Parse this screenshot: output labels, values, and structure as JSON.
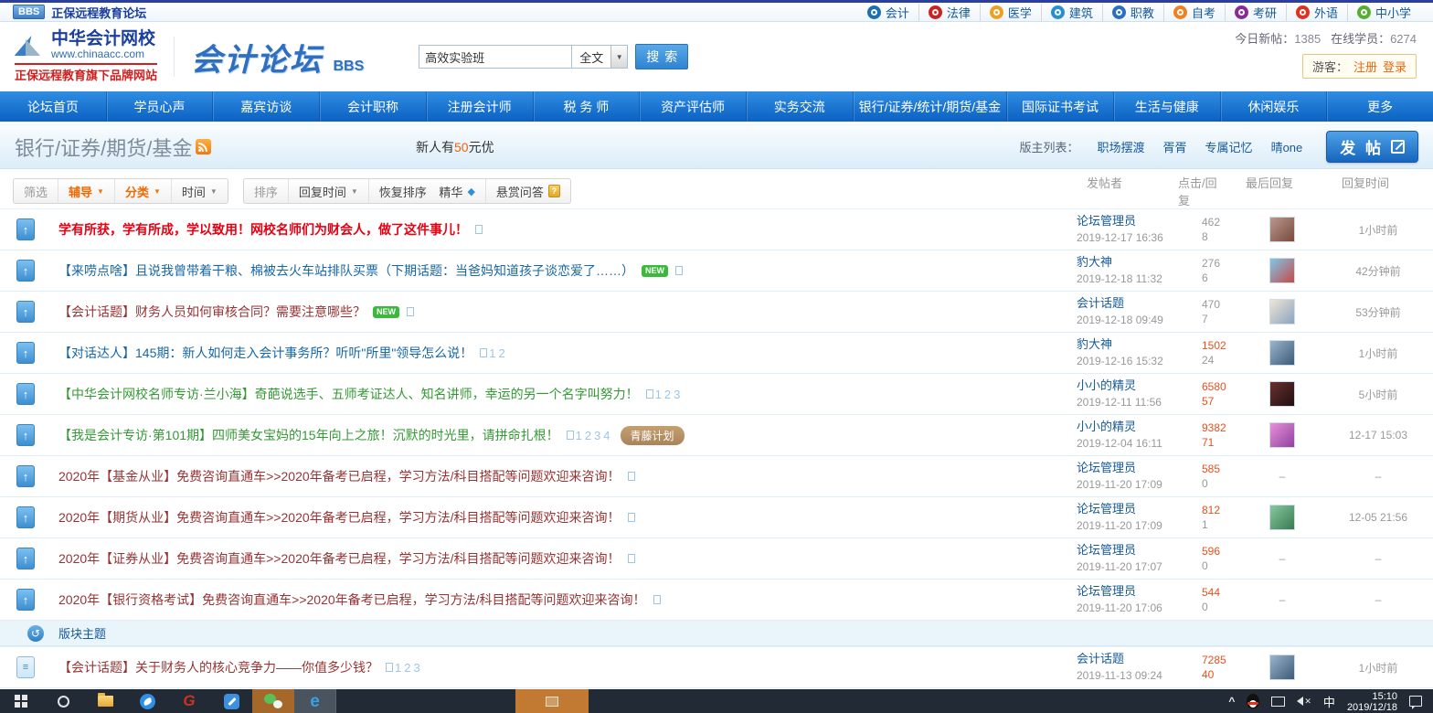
{
  "topbar": {
    "bbs_badge": "BBS",
    "site_title": "正保远程教育论坛",
    "links": [
      {
        "label": "会计",
        "color": "#1a6fb5"
      },
      {
        "label": "法律",
        "color": "#cc2222"
      },
      {
        "label": "医学",
        "color": "#f0a020"
      },
      {
        "label": "建筑",
        "color": "#2a8fd0"
      },
      {
        "label": "职教",
        "color": "#2a6fc0"
      },
      {
        "label": "自考",
        "color": "#f08020"
      },
      {
        "label": "考研",
        "color": "#8a2a9a"
      },
      {
        "label": "外语",
        "color": "#e03020"
      },
      {
        "label": "中小学",
        "color": "#55b030"
      }
    ]
  },
  "header": {
    "logo_title": "中华会计网校",
    "logo_url": "www.chinaacc.com",
    "logo_slogan": "正保远程教育旗下品牌网站",
    "forum_title": "会计论坛",
    "forum_suffix": "BBS",
    "search": {
      "value": "高效实验班",
      "scope": "全文",
      "button": "搜索"
    },
    "stats": {
      "today_label": "今日新帖：",
      "today_value": "1385",
      "online_label": "在线学员：",
      "online_value": "6274"
    },
    "guest": {
      "label": "游客：",
      "register": "注册",
      "login": "登录"
    }
  },
  "nav": {
    "items": [
      "论坛首页",
      "学员心声",
      "嘉宾访谈",
      "会计职称",
      "注册会计师",
      "税 务 师",
      "资产评估师",
      "实务交流",
      "银行/证券/统计/期货/基金",
      "国际证书考试",
      "生活与健康",
      "休闲娱乐",
      "更多"
    ]
  },
  "board": {
    "title": "银行/证券/期货/基金",
    "promo_prefix": "新人有",
    "promo_num": "50",
    "promo_suffix": "元优",
    "moderator_label": "版主列表：",
    "moderators": [
      "职场摆渡",
      "胥胥",
      "专属记忆",
      "晴one"
    ],
    "post_button": "发 帖"
  },
  "toolbar": {
    "filter_label": "筛选",
    "filter_tutoring": "辅导",
    "filter_category": "分类",
    "filter_time": "时间",
    "sort_label": "排序",
    "sort_value": "回复时间",
    "restore": "恢复排序",
    "digest": "精华",
    "bounty": "悬赏问答",
    "columns": {
      "author": "发帖者",
      "views": "点击/回复",
      "last_reply": "最后回复",
      "reply_time": "回复时间"
    }
  },
  "badge_new_text": "NEW",
  "section_row": {
    "label": "版块主题"
  },
  "threads": [
    {
      "title": "学有所获，学有所成，学以致用！网校名师们为财会人，做了这件事儿！",
      "color": "#e60012",
      "bold": true,
      "new": false,
      "pages": "",
      "tag": "",
      "author": "论坛管理员",
      "date": "2019-12-17 16:36",
      "views": "462",
      "views_hot": false,
      "replies": "8",
      "replies_hot": false,
      "avatar": {
        "c1": "#b89890",
        "c2": "#7a4a3a"
      },
      "last": "1小时前"
    },
    {
      "title": "【来唠点啥】且说我曾带着干粮、棉被去火车站排队买票（下期话题：当爸妈知道孩子谈恋爱了……）",
      "color": "#1667a7",
      "bold": false,
      "new": true,
      "pages": "",
      "tag": "",
      "author": "豹大神",
      "date": "2019-12-18 11:32",
      "views": "276",
      "views_hot": false,
      "replies": "6",
      "replies_hot": false,
      "avatar": {
        "c1": "#7ec8e8",
        "c2": "#c84848"
      },
      "last": "42分钟前"
    },
    {
      "title": "【会计话题】财务人员如何审核合同？需要注意哪些？",
      "color": "#993333",
      "bold": false,
      "new": true,
      "pages": "",
      "tag": "",
      "author": "会计话题",
      "date": "2019-12-18 09:49",
      "views": "470",
      "views_hot": false,
      "replies": "7",
      "replies_hot": false,
      "avatar": {
        "c1": "#f0e4d4",
        "c2": "#8aa4c0"
      },
      "last": "53分钟前"
    },
    {
      "title": "【对话达人】145期：新人如何走入会计事务所？听听\"所里\"领导怎么说！",
      "color": "#1667a7",
      "bold": false,
      "new": false,
      "pages": "12",
      "tag": "",
      "author": "豹大神",
      "date": "2019-12-16 15:32",
      "views": "1502",
      "views_hot": true,
      "replies": "24",
      "replies_hot": false,
      "avatar": {
        "c1": "#9ab4cc",
        "c2": "#3c5a78"
      },
      "last": "1小时前"
    },
    {
      "title": "【中华会计网校名师专访·兰小海】奇葩说选手、五师考证达人、知名讲师，幸运的另一个名字叫努力！",
      "color": "#339933",
      "bold": false,
      "new": false,
      "pages": "123",
      "tag": "",
      "author": "小小的精灵",
      "date": "2019-12-11 11:56",
      "views": "6580",
      "views_hot": true,
      "replies": "57",
      "replies_hot": true,
      "avatar": {
        "c1": "#6a3030",
        "c2": "#201010"
      },
      "last": "5小时前"
    },
    {
      "title": "【我是会计专访·第101期】四师美女宝妈的15年向上之旅！沉默的时光里，请拼命扎根！",
      "color": "#339933",
      "bold": false,
      "new": false,
      "pages": "1234",
      "tag": "青藤计划",
      "author": "小小的精灵",
      "date": "2019-12-04 16:11",
      "views": "9382",
      "views_hot": true,
      "replies": "71",
      "replies_hot": true,
      "avatar": {
        "c1": "#e890d8",
        "c2": "#9040a0"
      },
      "last": "12-17 15:03"
    },
    {
      "title": "2020年【基金从业】免费咨询直通车>>2020年备考已启程，学习方法/科目搭配等问题欢迎来咨询！",
      "color": "#993333",
      "bold": false,
      "new": false,
      "pages": "",
      "tag": "",
      "author": "论坛管理员",
      "date": "2019-11-20 17:09",
      "views": "585",
      "views_hot": true,
      "replies": "0",
      "replies_hot": false,
      "avatar": null,
      "last": "–"
    },
    {
      "title": "2020年【期货从业】免费咨询直通车>>2020年备考已启程，学习方法/科目搭配等问题欢迎来咨询！",
      "color": "#993333",
      "bold": false,
      "new": false,
      "pages": "",
      "tag": "",
      "author": "论坛管理员",
      "date": "2019-11-20 17:09",
      "views": "812",
      "views_hot": true,
      "replies": "1",
      "replies_hot": false,
      "avatar": {
        "c1": "#88c8a0",
        "c2": "#3a7a50"
      },
      "last": "12-05 21:56"
    },
    {
      "title": "2020年【证券从业】免费咨询直通车>>2020年备考已启程，学习方法/科目搭配等问题欢迎来咨询！",
      "color": "#993333",
      "bold": false,
      "new": false,
      "pages": "",
      "tag": "",
      "author": "论坛管理员",
      "date": "2019-11-20 17:07",
      "views": "596",
      "views_hot": true,
      "replies": "0",
      "replies_hot": false,
      "avatar": null,
      "last": "–"
    },
    {
      "title": "2020年【银行资格考试】免费咨询直通车>>2020年备考已启程，学习方法/科目搭配等问题欢迎来咨询！",
      "color": "#993333",
      "bold": false,
      "new": false,
      "pages": "",
      "tag": "",
      "author": "论坛管理员",
      "date": "2019-11-20 17:06",
      "views": "544",
      "views_hot": true,
      "replies": "0",
      "replies_hot": false,
      "avatar": null,
      "last": "–"
    }
  ],
  "board_threads": [
    {
      "title": "【会计话题】关于财务人的核心竞争力——你值多少钱？",
      "color": "#993333",
      "bold": false,
      "new": false,
      "pages": "123",
      "tag": "",
      "author": "会计话题",
      "date": "2019-11-13 09:24",
      "views": "7285",
      "views_hot": true,
      "replies": "40",
      "replies_hot": true,
      "avatar": {
        "c1": "#9ab4cc",
        "c2": "#3c5a78"
      },
      "last": "1小时前"
    }
  ],
  "taskbar": {
    "time": "15:10",
    "date": "2019/12/18",
    "ime": "中",
    "icons": [
      "start-icon",
      "search-icon",
      "file-explorer-icon",
      "dingtalk-icon",
      "g-app-icon",
      "notes-app-icon",
      "wechat-icon",
      "edge-icon",
      "flashing-app-icon",
      "chevron-up-icon",
      "qq-icon",
      "display-icon",
      "volume-muted-icon",
      "notification-icon"
    ]
  }
}
